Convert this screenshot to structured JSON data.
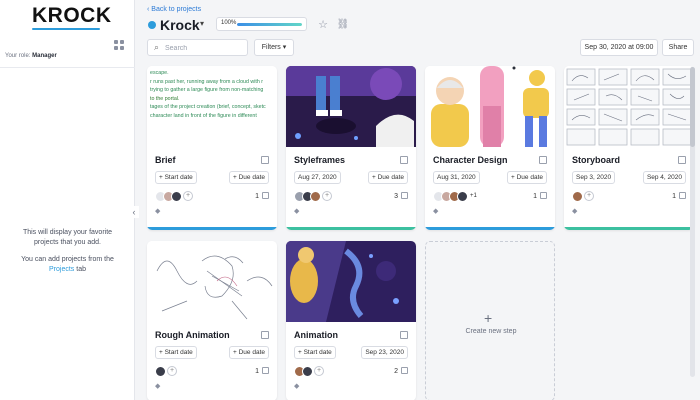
{
  "sidebar": {
    "logo": "KROCK",
    "role_label": "Your role:",
    "role_value": "Manager",
    "favorites_text": "This will display your favorite projects that you add.",
    "favorites_hint_prefix": "You can add projects from the",
    "favorites_hint_link": "Projects",
    "favorites_hint_suffix": "tab"
  },
  "header": {
    "back_label": "Back to projects",
    "project_name": "Krock",
    "progress_label": "100%",
    "progress_value": 1.0
  },
  "toolbar": {
    "search_placeholder": "Search",
    "filters_label": "Filters",
    "date_label": "Sep 30, 2020 at 09:00",
    "share_label": "Share"
  },
  "cards": [
    {
      "title": "Brief",
      "start": "+ Start date",
      "due": "+ Due date",
      "tasks": "1",
      "bar_color": "#2d9cdb",
      "extra": ""
    },
    {
      "title": "Styleframes",
      "start": "Aug 27, 2020",
      "due": "+ Due date",
      "tasks": "3",
      "bar_color": "#3cc0a0",
      "extra": ""
    },
    {
      "title": "Character Design",
      "start": "Aug 31, 2020",
      "due": "+ Due date",
      "tasks": "1",
      "bar_color": "#2d9cdb",
      "extra": "+1"
    },
    {
      "title": "Storyboard",
      "start": "Sep 3, 2020",
      "due": "Sep 4, 2020",
      "tasks": "1",
      "bar_color": "#3cc0a0",
      "extra": ""
    },
    {
      "title": "Rough Animation",
      "start": "+ Start date",
      "due": "+ Due date",
      "tasks": "1",
      "bar_color": "#2d9cdb",
      "extra": ""
    },
    {
      "title": "Animation",
      "start": "+ Start date",
      "due": "Sep 23, 2020",
      "tasks": "2",
      "bar_color": "#2d9cdb",
      "extra": ""
    }
  ],
  "brief_text": [
    "escape.",
    "r runs past her, running away from a cloud with r",
    "trying to gather a large figure from non-matching",
    "to the portal.",
    "tages of the project creation (brief, concept, sketc",
    "character land in front of the figure in different"
  ],
  "new_step_label": "Create new step",
  "colors": {
    "accent": "#2d9cdb",
    "success": "#3cc0a0"
  }
}
